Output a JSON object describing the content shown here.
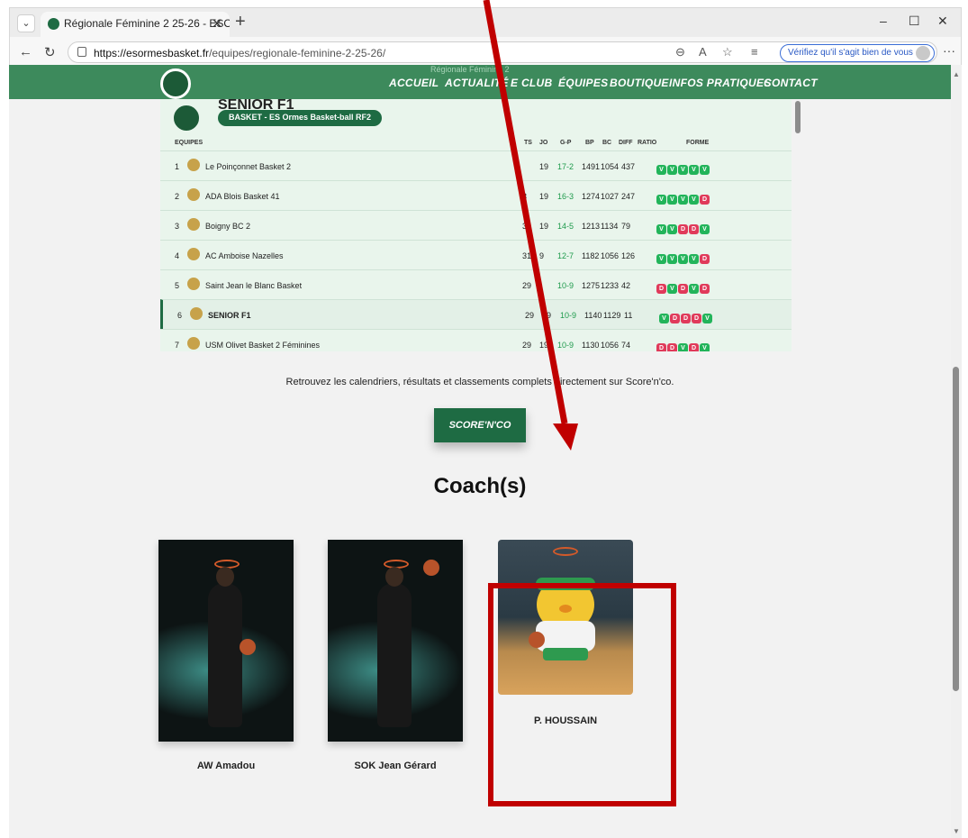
{
  "browser": {
    "tab_title": "Régionale Féminine 2 25-26 - ESO",
    "url_host": "https://esormesbasket.fr",
    "url_path": "/equipes/regionale-feminine-2-25-26/",
    "verify_label": "Vérifiez qu'il s'agit bien de vous"
  },
  "nav": {
    "ghost": "Régionale Féminine 2",
    "items": [
      "ACCUEIL",
      "ACTUALITÉ",
      "E CLUB",
      "ÉQUIPES",
      "BOUTIQUE",
      "INFOS PRATIQUES",
      "CONTACT"
    ]
  },
  "standings": {
    "team": "SENIOR F1",
    "badge": "BASKET - ES Ormes Basket-ball RF2",
    "headers": {
      "team": "EQUIPES",
      "pts": "TS",
      "jo": "JO",
      "gp": "G-P",
      "bp": "BP",
      "bc": "BC",
      "diff": "DIFF",
      "ratio": "RATIO",
      "form": "FORME"
    },
    "rows": [
      {
        "rank": "1",
        "name": "Le Poinçonnet Basket 2",
        "pts": "",
        "jo": "19",
        "gp": "17-2",
        "bp": "1491",
        "bc": "1054",
        "diff": "437",
        "form": [
          "V",
          "V",
          "V",
          "V",
          "V"
        ]
      },
      {
        "rank": "2",
        "name": "ADA Blois Basket 41",
        "pts": "3",
        "jo": "19",
        "gp": "16-3",
        "bp": "1274",
        "bc": "1027",
        "diff": "247",
        "form": [
          "V",
          "V",
          "V",
          "V",
          "D"
        ]
      },
      {
        "rank": "3",
        "name": "Boigny BC 2",
        "pts": "33",
        "jo": "19",
        "gp": "14-5",
        "bp": "1213",
        "bc": "1134",
        "diff": "79",
        "form": [
          "V",
          "V",
          "D",
          "D",
          "V"
        ]
      },
      {
        "rank": "4",
        "name": "AC Amboise Nazelles",
        "pts": "31",
        "jo": "9",
        "gp": "12-7",
        "bp": "1182",
        "bc": "1056",
        "diff": "126",
        "form": [
          "V",
          "V",
          "V",
          "V",
          "D"
        ]
      },
      {
        "rank": "5",
        "name": "Saint Jean le Blanc Basket",
        "pts": "29",
        "jo": "",
        "gp": "10-9",
        "bp": "1275",
        "bc": "1233",
        "diff": "42",
        "form": [
          "D",
          "V",
          "D",
          "V",
          "D"
        ]
      },
      {
        "rank": "6",
        "name": "SENIOR F1",
        "pts": "29",
        "jo": "19",
        "gp": "10-9",
        "bp": "1140",
        "bc": "1129",
        "diff": "11",
        "form": [
          "V",
          "D",
          "D",
          "D",
          "V"
        ]
      },
      {
        "rank": "7",
        "name": "USM Olivet Basket 2 Féminines",
        "pts": "29",
        "jo": "19",
        "gp": "10-9",
        "bp": "1130",
        "bc": "1056",
        "diff": "74",
        "form": [
          "D",
          "D",
          "V",
          "D",
          "V"
        ]
      }
    ]
  },
  "info_text": "Retrouvez les calendriers, résultats et classements complets directement sur Score'n'co.",
  "scoreco_button": "SCORE'N'CO",
  "coach_title": "Coach(s)",
  "coaches": [
    {
      "name": "AW Amadou"
    },
    {
      "name": "SOK Jean Gérard"
    },
    {
      "name": "P. HOUSSAIN"
    }
  ],
  "colors": {
    "brand_green": "#1e6b43",
    "nav_green": "#3d8a5c",
    "highlight_red": "#c00000",
    "win": "#22b45a",
    "loss": "#e03a5a"
  }
}
